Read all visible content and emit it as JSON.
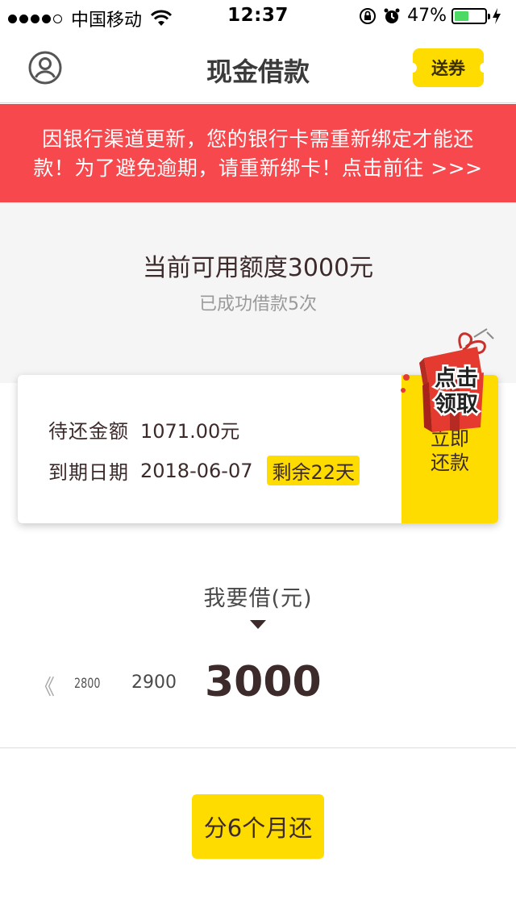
{
  "status_bar": {
    "carrier": "中国移动",
    "time": "12:37",
    "battery": "47%",
    "battery_level": 0.47
  },
  "nav": {
    "title": "现金借款",
    "coupon_label": "送券"
  },
  "notice": {
    "text": "因银行渠道更新，您的银行卡需重新绑定才能还款！为了避免逾期，请重新绑卡！点击前往 >>>"
  },
  "quota": {
    "title": "当前可用额度3000元",
    "subtitle": "已成功借款5次"
  },
  "repay_card": {
    "amount_label": "待还金额",
    "amount_value": "1071.00元",
    "due_label": "到期日期",
    "due_value": "2018-06-07",
    "remaining": "剩余22天",
    "repay_now_label": "立即还款",
    "gift_line1": "点击",
    "gift_line2": "领取"
  },
  "borrow": {
    "label": "我要借(元)",
    "scale_arrow": "《",
    "scale_values": [
      "2800",
      "2900"
    ],
    "selected_amount": "3000"
  },
  "installment": {
    "label": "分6个月还"
  },
  "colors": {
    "accent_yellow": "#ffdc00",
    "notice_red": "#f7484d",
    "text_dark": "#3d2b2b"
  }
}
